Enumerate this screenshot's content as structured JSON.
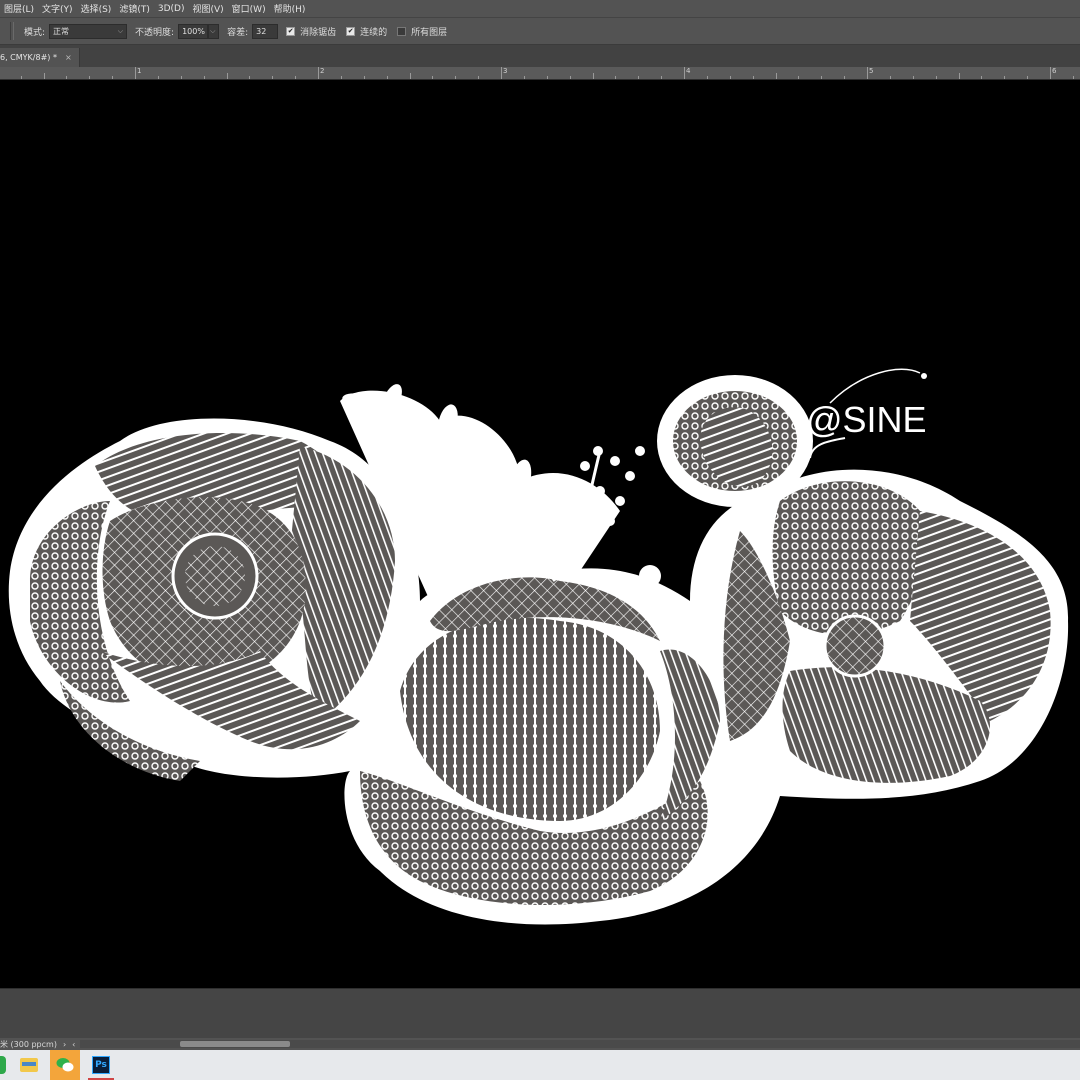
{
  "menu": {
    "items": [
      "图层(L)",
      "文字(Y)",
      "选择(S)",
      "滤镜(T)",
      "3D(D)",
      "视图(V)",
      "窗口(W)",
      "帮助(H)"
    ]
  },
  "options": {
    "mode_label": "模式:",
    "mode_value": "正常",
    "opacity_label": "不透明度:",
    "opacity_value": "100%",
    "tolerance_label": "容差:",
    "tolerance_value": "32",
    "antialias_label": "消除锯齿",
    "antialias_checked": true,
    "contiguous_label": "连续的",
    "contiguous_checked": true,
    "all_layers_label": "所有图层",
    "all_layers_checked": false
  },
  "document_tab": {
    "title": "6, CMYK/8#) *",
    "close": "×"
  },
  "ruler": {
    "numbers": [
      "1",
      "2",
      "3",
      "4",
      "5",
      "6"
    ]
  },
  "artwork": {
    "watermark": "@SINE"
  },
  "status": {
    "text": "米 (300 ppcm)",
    "arrow": "›",
    "left_arrow": "‹"
  },
  "taskbar": {
    "apps": [
      "file-explorer",
      "wechat",
      "photoshop"
    ],
    "ps_label": "Ps"
  }
}
